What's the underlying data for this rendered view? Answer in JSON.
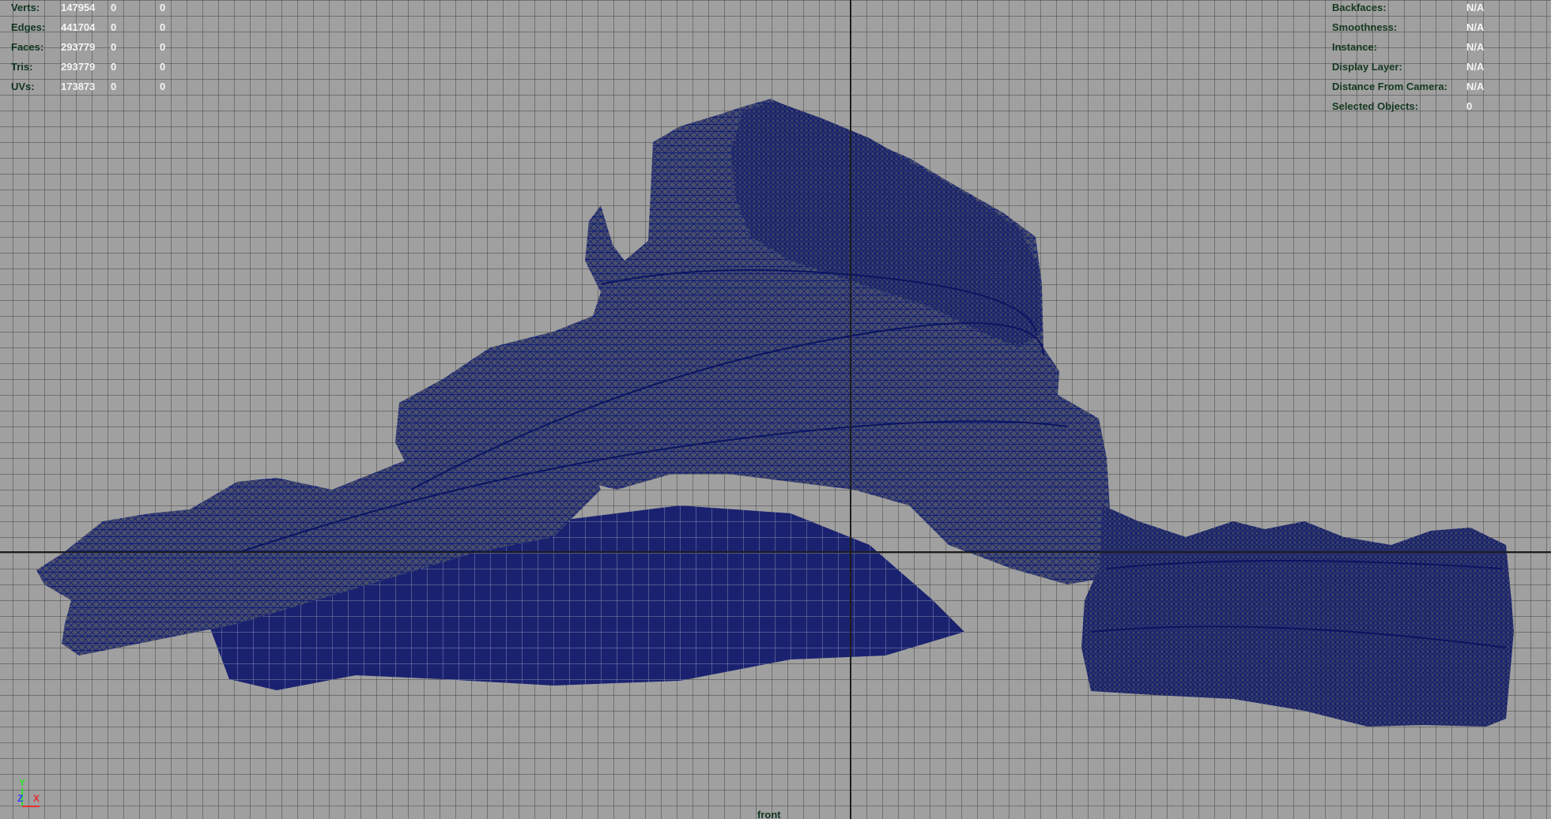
{
  "hud_left": {
    "rows": [
      {
        "label": "Verts:",
        "v1": "147954",
        "v2": "0",
        "v3": "0"
      },
      {
        "label": "Edges:",
        "v1": "441704",
        "v2": "0",
        "v3": "0"
      },
      {
        "label": "Faces:",
        "v1": "293779",
        "v2": "0",
        "v3": "0"
      },
      {
        "label": "Tris:",
        "v1": "293779",
        "v2": "0",
        "v3": "0"
      },
      {
        "label": "UVs:",
        "v1": "173873",
        "v2": "0",
        "v3": "0"
      }
    ]
  },
  "hud_right": {
    "rows": [
      {
        "label": "Backfaces:",
        "value": "N/A"
      },
      {
        "label": "Smoothness:",
        "value": "N/A"
      },
      {
        "label": "Instance:",
        "value": "N/A"
      },
      {
        "label": "Display Layer:",
        "value": "N/A"
      },
      {
        "label": "Distance From Camera:",
        "value": "N/A"
      },
      {
        "label": "Selected Objects:",
        "value": "0"
      }
    ]
  },
  "camera": {
    "name": "front"
  },
  "axis_gizmo": {
    "y": "Y",
    "z": "Z",
    "x": "X"
  },
  "colors": {
    "background": "#a0a0a0",
    "grid": "#4b4b4b",
    "axis": "#1d1d1d",
    "wireframe": "#0d1a6e",
    "hud_label": "#10351f",
    "hud_value": "#f4f4f4"
  },
  "icons": [
    "axis-gizmo-icon"
  ]
}
